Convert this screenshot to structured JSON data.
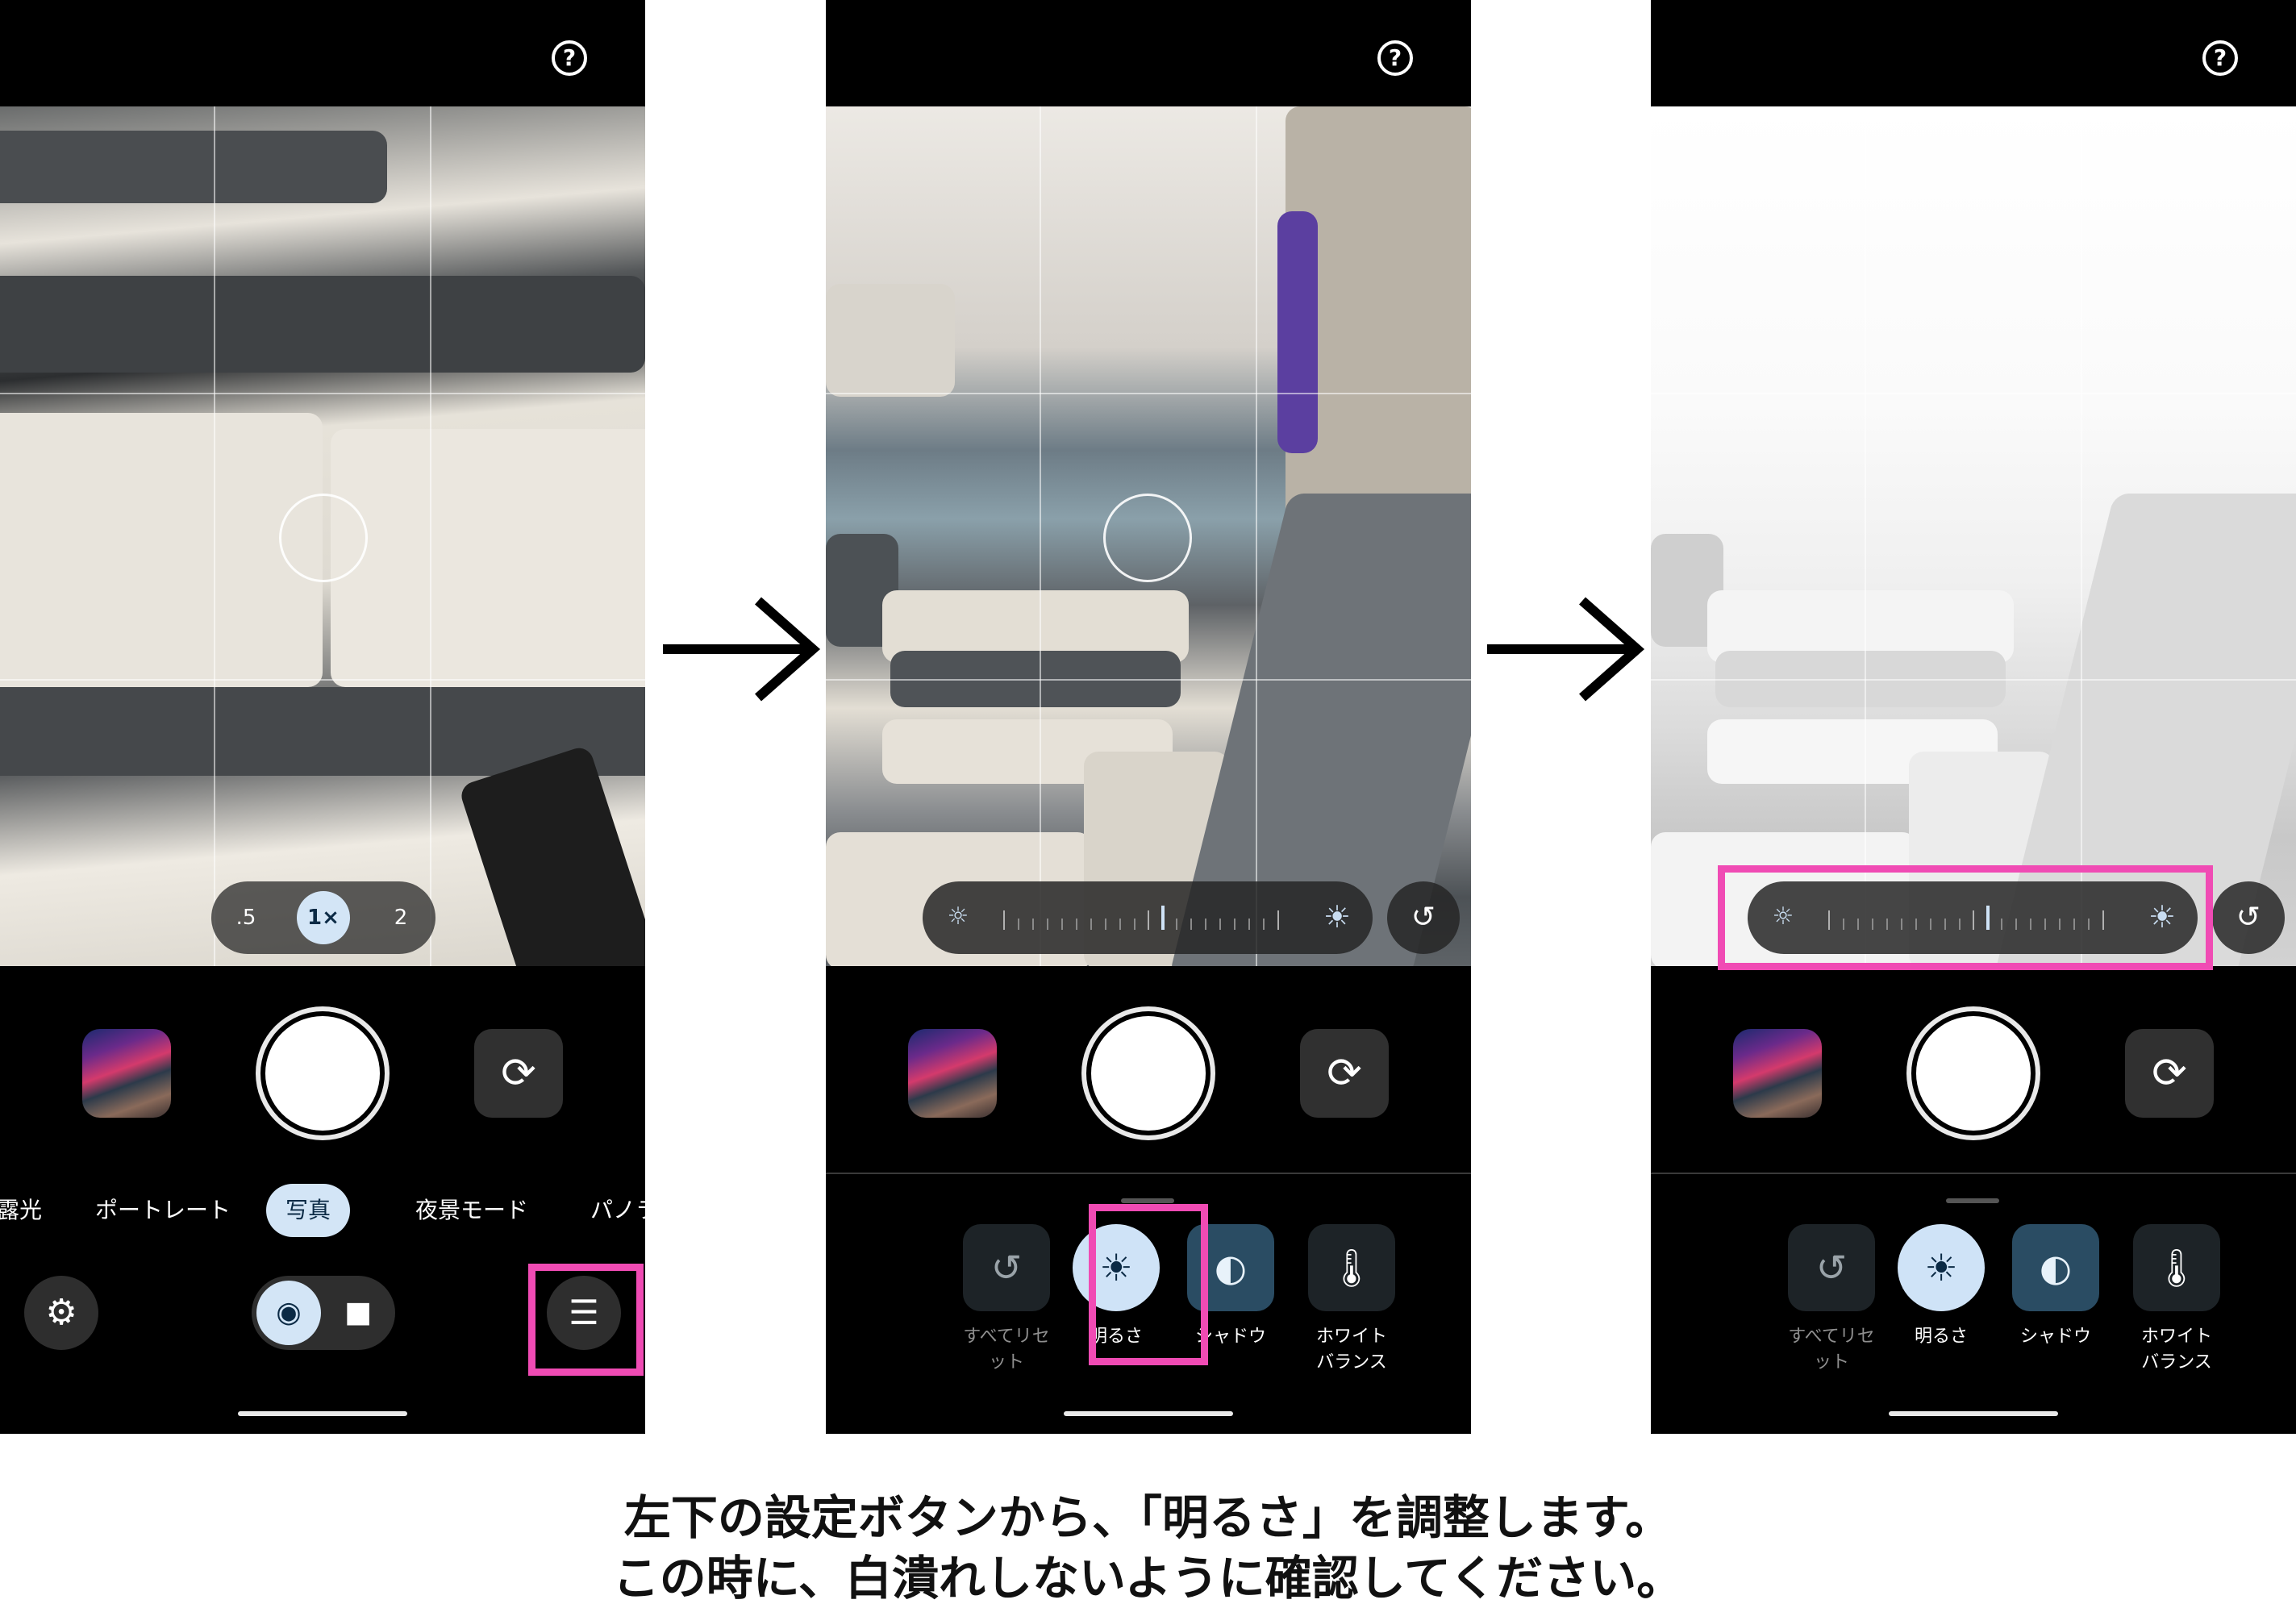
{
  "help_icon": "?",
  "phone1": {
    "zoom_levels": [
      ".5",
      "1×",
      "2"
    ],
    "zoom_selected": "1×",
    "modes": [
      "露光",
      "ポートレート",
      "写真",
      "夜景モード",
      "パノラ"
    ],
    "active_mode": "写真"
  },
  "adjust_panel": {
    "items": [
      {
        "label": "すべてリセット"
      },
      {
        "label": "明るさ"
      },
      {
        "label": "シャドウ"
      },
      {
        "label": "ホワイト\nバランス"
      }
    ]
  },
  "icons": {
    "help": "help-circle-icon",
    "flip": "flip-camera-icon",
    "settings": "camera-settings-gear-icon",
    "camera": "camera-icon",
    "video": "video-icon",
    "adjust": "tune-sliders-icon",
    "brightness": "brightness-sun-icon",
    "shadow": "contrast-moon-icon",
    "white_balance": "thermometer-icon",
    "reset": "reset-icon"
  },
  "highlight_color": "#f04bb4",
  "caption": {
    "line1": "左下の設定ボタンから、「明るさ」を調整します。",
    "line2": "この時に、白潰れしないように確認してください。"
  }
}
